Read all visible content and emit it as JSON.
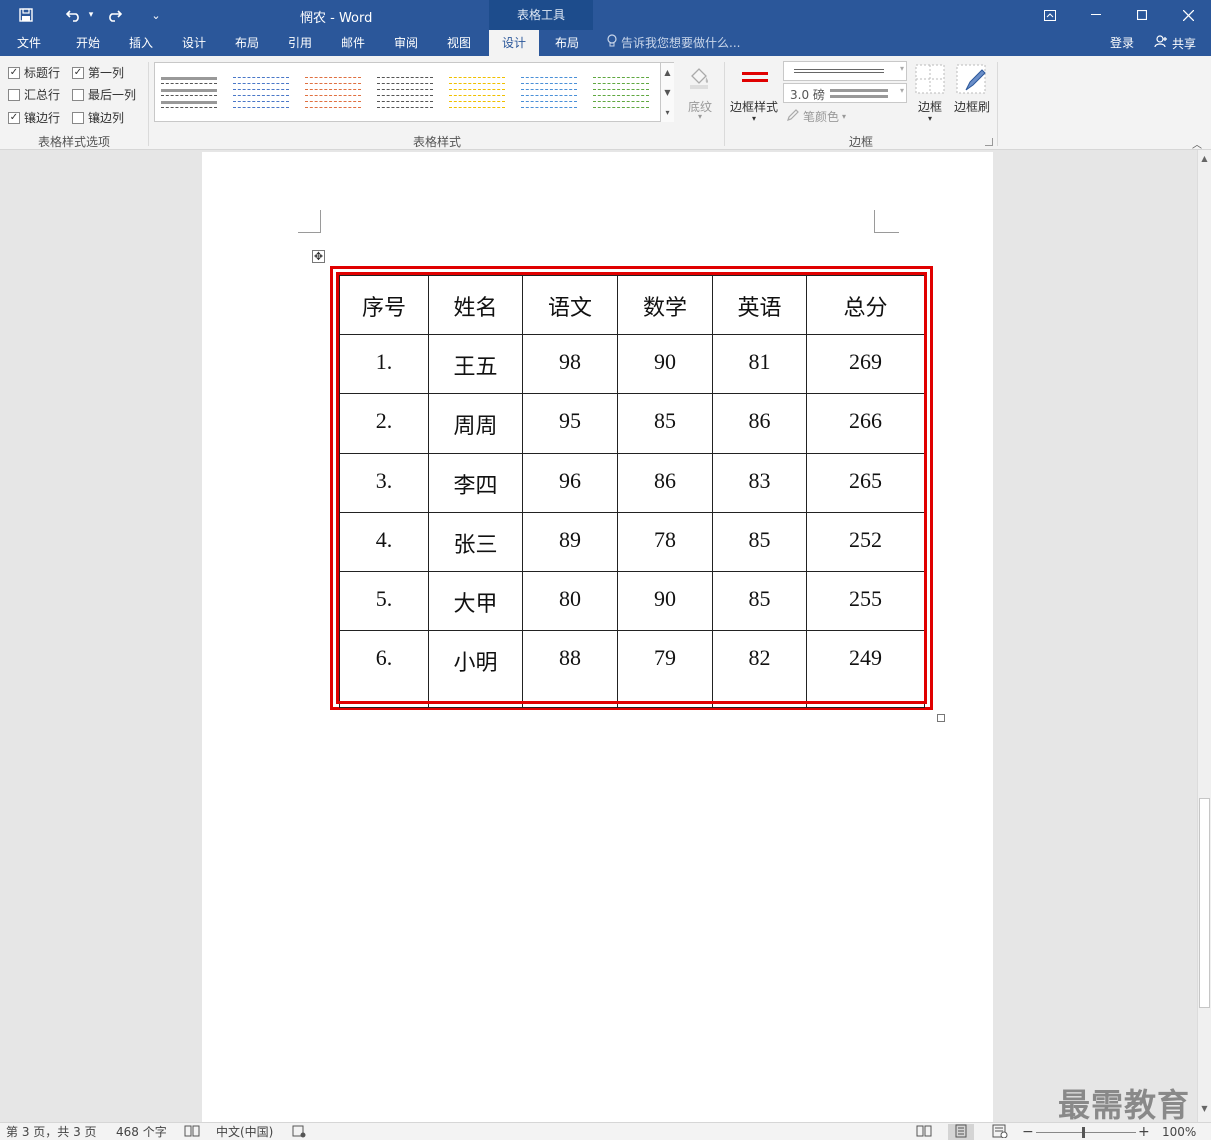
{
  "titlebar": {
    "doc_title": "惘农 - Word",
    "context_tool": "表格工具",
    "customize_glyph": "⌄"
  },
  "tabs": [
    {
      "label": "文件"
    },
    {
      "label": "开始"
    },
    {
      "label": "插入"
    },
    {
      "label": "设计"
    },
    {
      "label": "布局"
    },
    {
      "label": "引用"
    },
    {
      "label": "邮件"
    },
    {
      "label": "审阅"
    },
    {
      "label": "视图"
    },
    {
      "label": "设计",
      "active": true
    },
    {
      "label": "布局"
    }
  ],
  "tellme": {
    "placeholder": "告诉我您想要做什么..."
  },
  "account": {
    "signin": "登录",
    "share": "共享"
  },
  "ribbon": {
    "options_group": {
      "label": "表格样式选项",
      "checkboxes": [
        {
          "label": "标题行",
          "checked": true
        },
        {
          "label": "第一列",
          "checked": true
        },
        {
          "label": "汇总行",
          "checked": false
        },
        {
          "label": "最后一列",
          "checked": false
        },
        {
          "label": "镶边行",
          "checked": true
        },
        {
          "label": "镶边列",
          "checked": false
        }
      ]
    },
    "styles_group": {
      "label": "表格样式",
      "swatch_colors": [
        "#555555",
        "#4a78c8",
        "#e07040",
        "#555555",
        "#f0c000",
        "#4a90d8",
        "#60a840"
      ],
      "shading_label": "底纹"
    },
    "borders_group": {
      "label": "边框",
      "border_styles_label": "边框样式",
      "pen_weight": "3.0 磅",
      "pen_color_label": "笔颜色",
      "borders_label": "边框",
      "border_painter_label": "边框刷"
    }
  },
  "table": {
    "headers": [
      "序号",
      "姓名",
      "语文",
      "数学",
      "英语",
      "总分"
    ],
    "rows": [
      [
        "1.",
        "王五",
        "98",
        "90",
        "81",
        "269"
      ],
      [
        "2.",
        "周周",
        "95",
        "85",
        "86",
        "266"
      ],
      [
        "3.",
        "李四",
        "96",
        "86",
        "83",
        "265"
      ],
      [
        "4.",
        "张三",
        "89",
        "78",
        "85",
        "252"
      ],
      [
        "5.",
        "大甲",
        "80",
        "90",
        "85",
        "255"
      ],
      [
        "6.",
        "小明",
        "88",
        "79",
        "82",
        "249"
      ]
    ],
    "border_color": "#e00000"
  },
  "statusbar": {
    "page_info": "第 3 页，共 3 页",
    "word_count": "468 个字",
    "language": "中文(中国)",
    "zoom": "100%"
  },
  "watermark": "最需教育"
}
